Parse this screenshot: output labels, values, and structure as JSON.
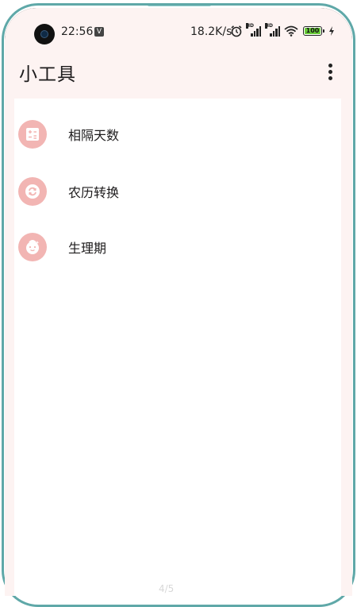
{
  "status_bar": {
    "time": "22:56",
    "notification_badge": "V",
    "net_speed": "18.2K/s",
    "battery_level": "100",
    "icons": [
      "alarm-icon",
      "signal-hd-icon",
      "signal-hd-icon",
      "wifi-icon",
      "battery-icon",
      "charging-icon"
    ]
  },
  "app_bar": {
    "title": "小工具",
    "menu_icon": "more-vert-icon"
  },
  "tools": [
    {
      "label": "相隔天数",
      "icon": "calculator-icon"
    },
    {
      "label": "农历转换",
      "icon": "refresh-icon"
    },
    {
      "label": "生理期",
      "icon": "baby-face-icon"
    }
  ],
  "page_indicator": "4/5",
  "colors": {
    "icon_bg": "#f2b5b3",
    "app_bar_bg": "#fdf3f2",
    "frame": "#5fa8a8",
    "battery": "#6acd3a"
  }
}
